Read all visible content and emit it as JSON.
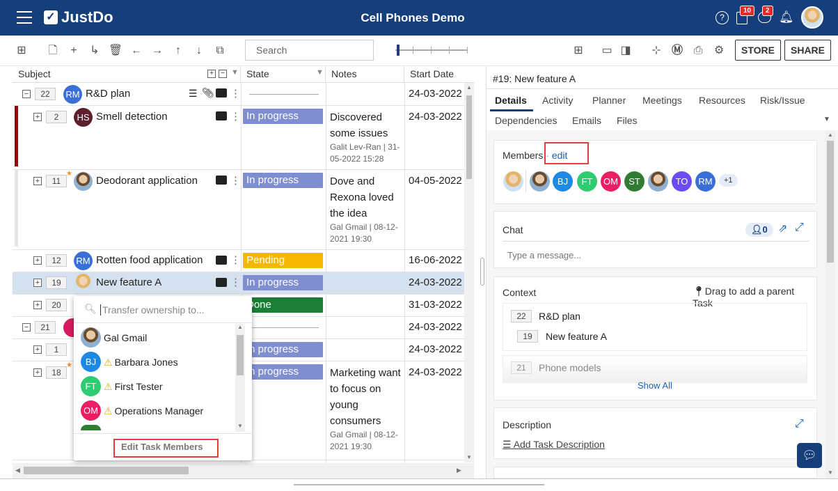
{
  "header": {
    "title": "Cell Phones Demo",
    "logo": "JustDo",
    "notif_count_1": "10",
    "notif_count_2": "2"
  },
  "toolbar": {
    "search_placeholder": "Search",
    "store": "STORE",
    "share": "SHARE"
  },
  "grid": {
    "columns": [
      "Subject",
      "State",
      "Notes",
      "Start Date"
    ],
    "rows": [
      {
        "num": "22",
        "avatar": "RM",
        "subject": "R&D plan",
        "state": "",
        "date": "24-03-2022"
      },
      {
        "num": "2",
        "avatar": "HS",
        "subject": "Smell detection",
        "state": "In progress",
        "notes": "Discovered some issues",
        "meta": "Galit Lev-Ran | 31-05-2022 15:28",
        "date": "24-03-2022"
      },
      {
        "num": "11",
        "avatar": "",
        "subject": "Deodorant application",
        "state": "In progress",
        "notes": "Dove and Rexona loved the idea",
        "meta": "Gal Gmail | 08-12-2021 19:30",
        "date": "04-05-2022"
      },
      {
        "num": "12",
        "avatar": "RM",
        "subject": "Rotten food application",
        "state": "Pending",
        "date": "16-06-2022"
      },
      {
        "num": "19",
        "avatar": "",
        "subject": "New feature A",
        "state": "In progress",
        "date": "24-03-2022"
      },
      {
        "num": "20",
        "state": "Done",
        "date": "31-03-2022"
      },
      {
        "num": "21",
        "date": "24-03-2022"
      },
      {
        "num": "1",
        "state": "In progress",
        "date": "24-03-2022"
      },
      {
        "num": "18",
        "state": "In progress",
        "notes": "Marketing want to focus on young consumers",
        "meta": "Gal Gmail | 08-12-2021 19:30",
        "date": "24-03-2022"
      }
    ]
  },
  "dropdown": {
    "placeholder": "Transfer ownership to...",
    "items": [
      {
        "initials": "",
        "name": "Gal Gmail"
      },
      {
        "initials": "BJ",
        "name": "Barbara Jones"
      },
      {
        "initials": "FT",
        "name": "First Tester"
      },
      {
        "initials": "OM",
        "name": "Operations Manager"
      }
    ],
    "edit_members": "Edit Task Members"
  },
  "panel": {
    "title": "#19: New feature A",
    "tabs": [
      "Details",
      "Activity",
      "Planner",
      "Meetings",
      "Resources",
      "Risk/Issue",
      "Dependencies",
      "Emails",
      "Files"
    ],
    "members_label": "Members",
    "members_sep": "·",
    "members_edit": "edit",
    "members": [
      "BJ",
      "FT",
      "OM",
      "ST",
      "TO",
      "RM"
    ],
    "members_more": "+1",
    "chat_label": "Chat",
    "chat_count": "0",
    "chat_placeholder": "Type a message...",
    "context_label": "Context",
    "context_drag": "Drag to add a parent Task",
    "context_items": [
      {
        "num": "22",
        "name": "R&D plan"
      },
      {
        "num": "19",
        "name": "New feature A"
      },
      {
        "num": "21",
        "name": "Phone models"
      }
    ],
    "show_all": "Show All",
    "description_label": "Description",
    "add_description": "Add Task Description"
  }
}
